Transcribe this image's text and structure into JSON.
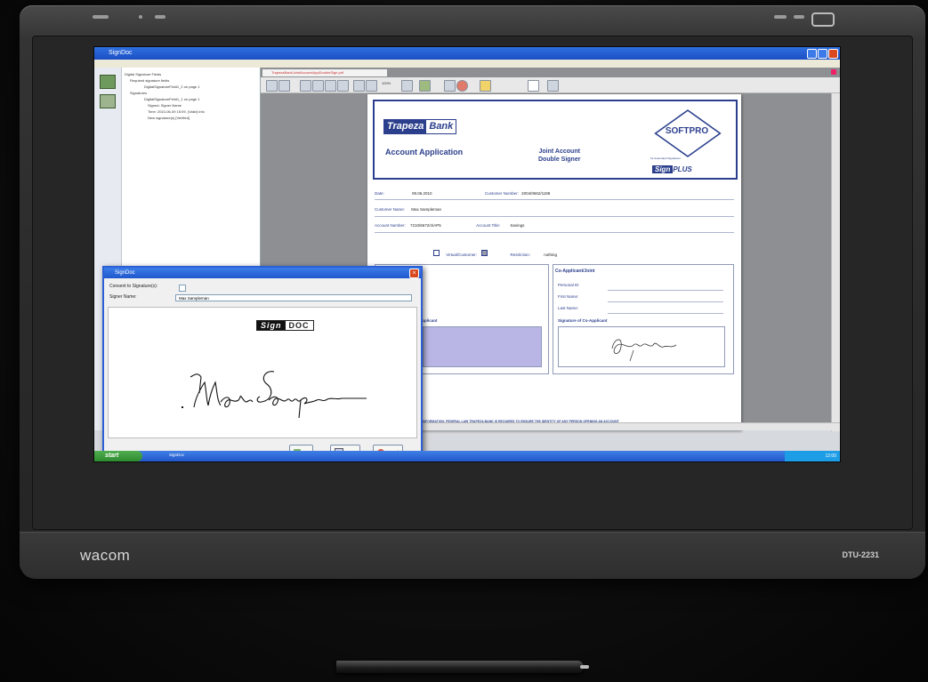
{
  "device": {
    "brand": "wacom",
    "model": "DTU-2231"
  },
  "app": {
    "window_title": "SignDoc",
    "tree": [
      "Digital Signature Fields",
      "Required signature fields",
      "DigitalSignatureField1_2 on page 1",
      "Signatures",
      "DigitalSignatureField1_1 on page 1",
      "Signed: Signer Name",
      "Time: 2010-06-09 15:09, (Valid) Info",
      "New signature(s) [Verified]"
    ],
    "doc_tab": "TrapezaBankJointAccountAppDoubleSign.pdf",
    "zoom": "100%"
  },
  "form": {
    "bank_a": "Trapeza",
    "bank_b": "Bank",
    "title": "Account Application",
    "joint_line1": "Joint Account",
    "joint_line2": "Double Signer",
    "softpro": "SOFTPRO",
    "for_line": "for Automated Signatures",
    "sigplus_a": "Sign",
    "sigplus_b": "PLUS",
    "rows": [
      {
        "label": "Date:",
        "value": "09.06.2010",
        "label2": "Customer Number:",
        "value2": "2004/0662/1188"
      },
      {
        "label": "Customer Name:",
        "value": "Max Sampleman"
      },
      {
        "label": "Account Number:",
        "value": "7210/6672/4/AP5",
        "label2": "Account Title:",
        "value2": "Savings"
      },
      {
        "label": "",
        "value": "",
        "label2": "Virtual/Customer:",
        "value2": "",
        "label3": "Restriction:",
        "value3": "nothing"
      }
    ],
    "co_head": "Co-Applicant/Joint",
    "co_fields": [
      "Personal ID",
      "First Name:",
      "Last Name:"
    ],
    "sig_applicant": "Applicant",
    "sig_co": "Signature of Co-Applicant",
    "disclaimer": "IMPORTANT INFORMATION: FEDERAL LAW TRAPEZA BANK IS REQUIRED TO ENSURE THE IDENTITY OF ANY PERSON OPENING AN ACCOUNT"
  },
  "dialog": {
    "title": "SignDoc",
    "consent_label": "Consent to Signature(s):",
    "signer_label": "Signer Name:",
    "signer_value": "Max Sampleman",
    "logo_a": "Sign",
    "logo_b": "DOC",
    "ok": "OK",
    "erase": "Erase",
    "cancel": "Cancel"
  },
  "taskbar": {
    "start": "start",
    "item": "SignDoc",
    "clock": "12:00"
  },
  "colors": {
    "brand_blue": "#2b3f8c",
    "xp_title": "#2f6fe0",
    "start_green": "#3c9a3c"
  }
}
